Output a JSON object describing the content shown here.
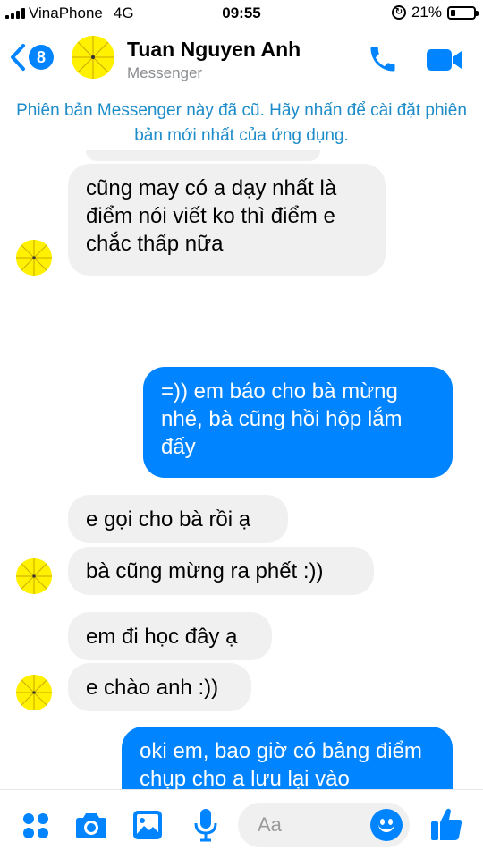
{
  "status_bar": {
    "carrier": "VinaPhone",
    "network": "4G",
    "time": "09:55",
    "battery": "21%",
    "battery_level": 0.21
  },
  "header": {
    "back_count": "8",
    "name": "Tuan Nguyen Anh",
    "subtitle": "Messenger"
  },
  "banner": "Phiên bản Messenger này đã cũ. Hãy nhấn để cài đặt phiên bản mới nhất của ứng dụng.",
  "messages": [
    {
      "from": "them",
      "text": "cũng may có a dạy nhất là điểm nói viết ko thì điểm e chắc thấp nữa"
    },
    {
      "from": "me",
      "text": "=)) em báo cho bà mừng nhé, bà cũng hồi hộp lắm đấy"
    },
    {
      "from": "them",
      "text": "e gọi cho bà rồi ạ"
    },
    {
      "from": "them",
      "text": "bà cũng mừng ra phết :))"
    },
    {
      "from": "them",
      "text": "em đi học đây ạ"
    },
    {
      "from": "them",
      "text": "e chào anh :))"
    },
    {
      "from": "me",
      "text": "oki em, bao giờ có bảng điểm chụp cho a lưu lại vào"
    }
  ],
  "composer": {
    "placeholder": "Aa"
  },
  "colors": {
    "accent": "#0084ff",
    "banner_text": "#1d8cc9",
    "incoming_bubble": "#f1f0f0",
    "avatar": "#fff100"
  },
  "icons": [
    "menu-dots-icon",
    "camera-icon",
    "gallery-icon",
    "microphone-icon",
    "emoji-icon",
    "thumbs-up-icon",
    "phone-icon",
    "video-icon",
    "back-chevron-icon"
  ]
}
